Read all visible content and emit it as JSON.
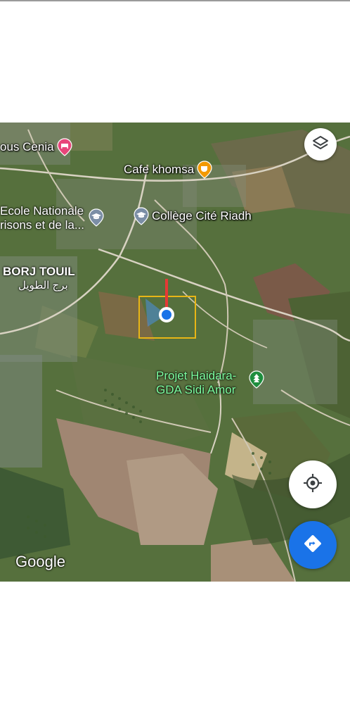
{
  "map": {
    "type": "satellite",
    "brand": "Google",
    "places": [
      {
        "name": "ous Cenia",
        "icon": "hotel-pin-icon",
        "color": "#e8457a"
      },
      {
        "name": "Cafe khomsa",
        "icon": "cafe-pin-icon",
        "color": "#f29900"
      },
      {
        "name_line1": "Ecole Nationale",
        "name_line2": "risons et de la...",
        "icon": "school-pin-icon",
        "color": "#7b8ea6"
      },
      {
        "name": "Collège Cité Riadh",
        "icon": "school-pin-icon",
        "color": "#7b8ea6"
      },
      {
        "name_line1": "Projet Haidara-",
        "name_line2": "GDA Sidi Amor",
        "icon": "park-pin-icon",
        "color": "#1e8e3e"
      }
    ],
    "area": {
      "name": "BORJ TOUIL",
      "name_ar": "برج الطويل"
    }
  },
  "controls": {
    "layers": "layers-icon",
    "my_location": "my-location-icon",
    "directions": "directions-icon"
  },
  "colors": {
    "accent_blue": "#1a73e8",
    "highlight": "#e8b616",
    "marker_red": "#e53935"
  }
}
